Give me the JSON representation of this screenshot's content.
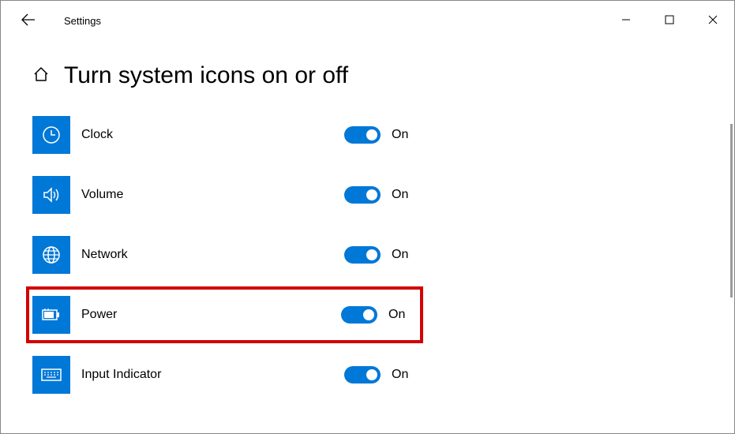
{
  "app_title": "Settings",
  "page_title": "Turn system icons on or off",
  "accent_color": "#0078d7",
  "highlight_color": "#d30000",
  "items": [
    {
      "icon": "clock-icon",
      "label": "Clock",
      "state": "On",
      "on": true,
      "highlighted": false
    },
    {
      "icon": "volume-icon",
      "label": "Volume",
      "state": "On",
      "on": true,
      "highlighted": false
    },
    {
      "icon": "network-icon",
      "label": "Network",
      "state": "On",
      "on": true,
      "highlighted": false
    },
    {
      "icon": "power-icon",
      "label": "Power",
      "state": "On",
      "on": true,
      "highlighted": true
    },
    {
      "icon": "input-indicator-icon",
      "label": "Input Indicator",
      "state": "On",
      "on": true,
      "highlighted": false
    }
  ]
}
